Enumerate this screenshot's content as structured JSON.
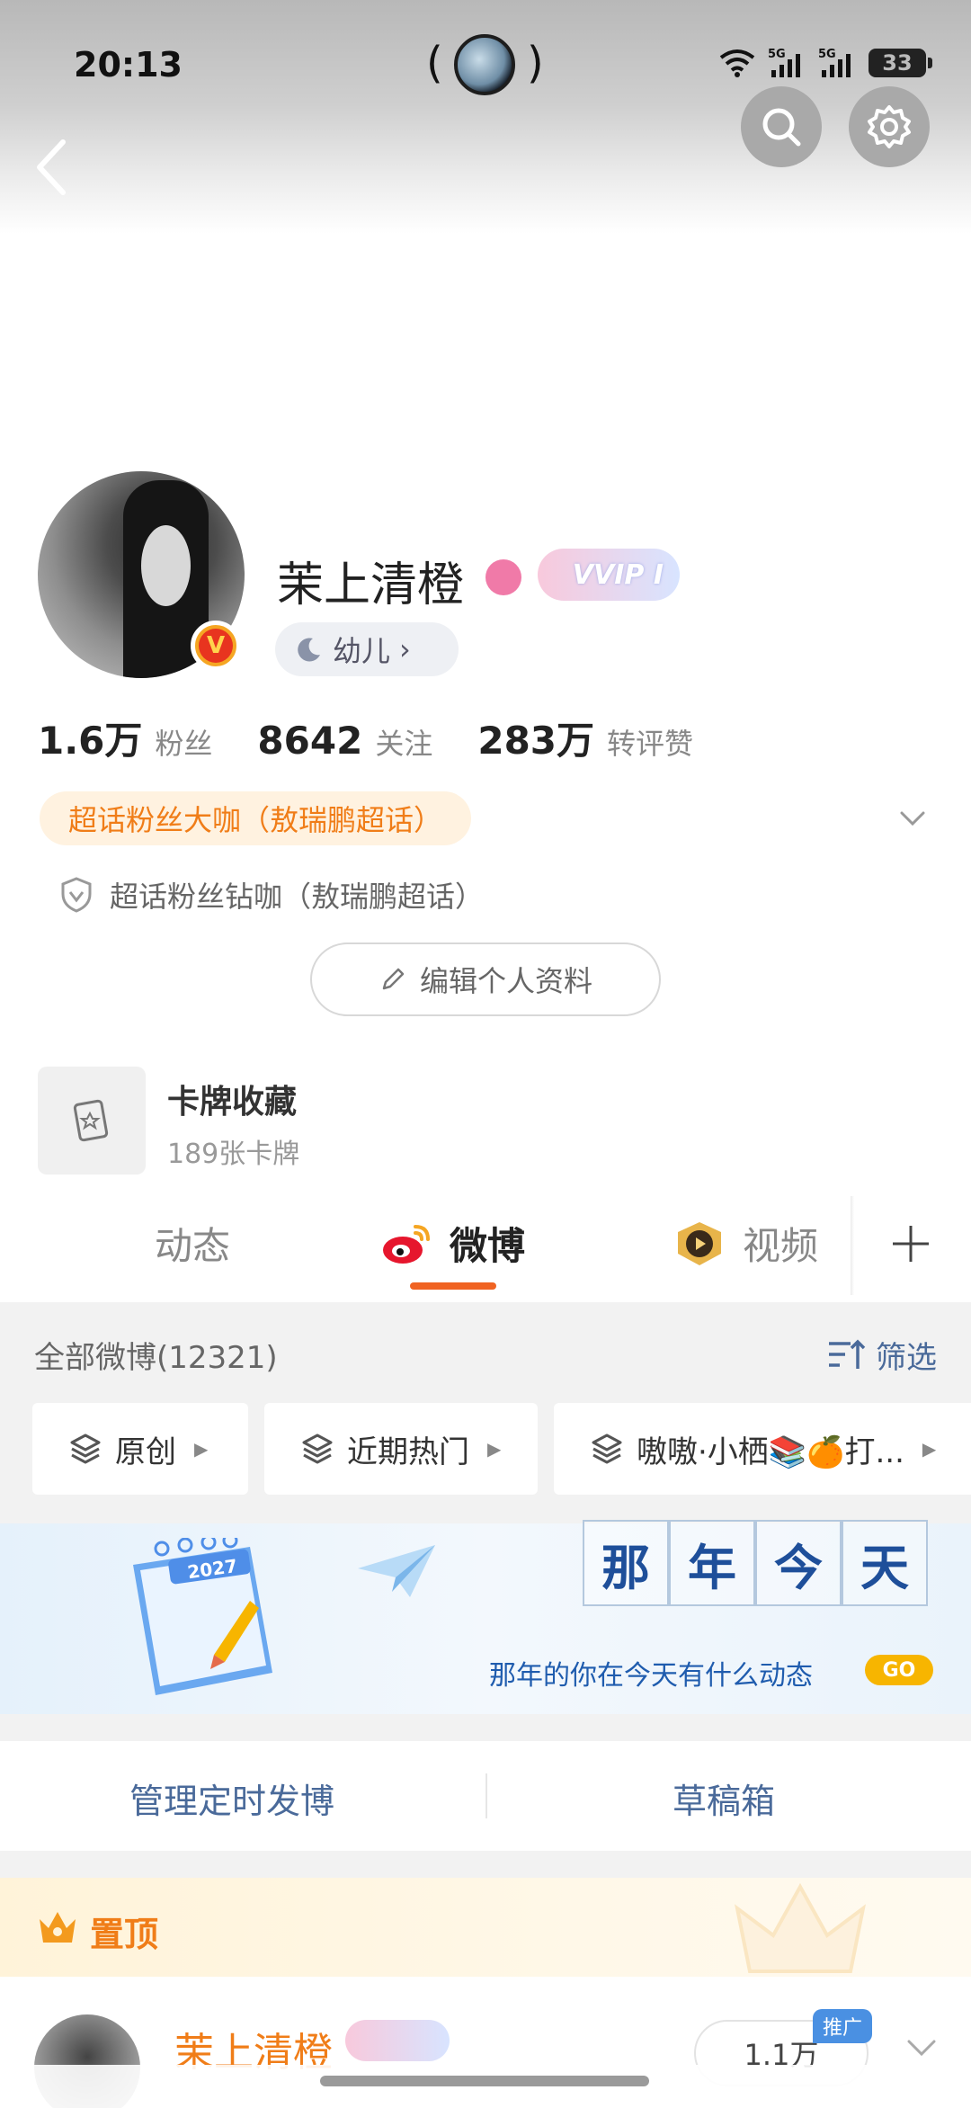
{
  "status_bar": {
    "time": "20:13",
    "battery": "33",
    "network_1": "5G",
    "network_2": "5G"
  },
  "profile": {
    "name": "茉上清橙",
    "vip_label": "VVIP I",
    "level_label": "幼儿",
    "level_chevron": "›"
  },
  "stats": [
    {
      "value": "1.6万",
      "label": "粉丝"
    },
    {
      "value": "8642",
      "label": "关注"
    },
    {
      "value": "283万",
      "label": "转评赞"
    }
  ],
  "badges": {
    "super_fan": "超话粉丝大咖（敖瑞鹏超话）",
    "diamond": "超话粉丝钻咖（敖瑞鹏超话）"
  },
  "edit_profile_label": "编辑个人资料",
  "card_collection": {
    "title": "卡牌收藏",
    "subtitle": "189张卡牌"
  },
  "tabs": [
    {
      "label": "动态"
    },
    {
      "label": "微博"
    },
    {
      "label": "视频"
    }
  ],
  "feed": {
    "all_label": "全部微博(12321)",
    "filter_label": "筛选",
    "chips": [
      "原创",
      "近期热门",
      "嗷嗷·小栖📚🍊打..."
    ]
  },
  "banner": {
    "title_chars": [
      "那",
      "年",
      "今",
      "天"
    ],
    "subtitle": "那年的你在今天有什么动态",
    "go_label": "GO",
    "calendar_year": "2027"
  },
  "manage": {
    "scheduled": "管理定时发博",
    "drafts": "草稿箱"
  },
  "pinned": {
    "label": "置顶",
    "post_author": "茉上清橙",
    "promo_tag": "推广",
    "follow_count": "1.1万"
  },
  "colors": {
    "accent": "#f06322",
    "orange_text": "#f07d18",
    "link_blue": "#4a6a9a"
  }
}
